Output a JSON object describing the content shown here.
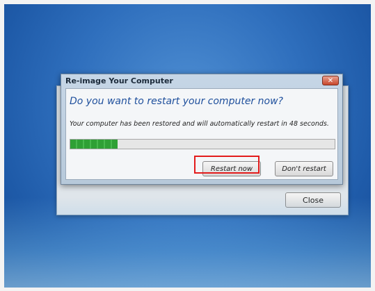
{
  "back_dialog": {
    "close_label": "Close"
  },
  "dialog": {
    "title": "Re-image Your Computer",
    "title_close_glyph": "✕",
    "heading": "Do you want to restart your computer now?",
    "message": "Your computer has been restored and will automatically restart in 48 seconds.",
    "progress_fraction": 0.18,
    "progress_color": "#2fa035",
    "restart_label": "Restart now",
    "dont_restart_label": "Don't restart"
  },
  "annotation": {
    "highlight_color": "#e31b1b",
    "highlights": "restart-now-button"
  }
}
